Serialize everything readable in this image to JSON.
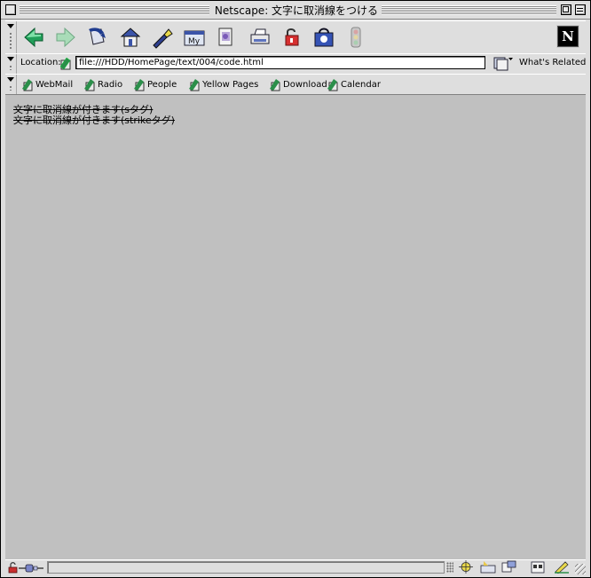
{
  "window": {
    "title": "Netscape: 文字に取消線をつける"
  },
  "nav_toolbar": {
    "buttons": [
      "back",
      "forward",
      "reload",
      "home",
      "search",
      "my-netscape",
      "images",
      "print",
      "security",
      "shop",
      "stop"
    ]
  },
  "location_bar": {
    "label": "Location:",
    "url": "file:///HDD/HomePage/text/004/code.html",
    "related_label": "What's Related"
  },
  "bookmarks": [
    "WebMail",
    "Radio",
    "People",
    "Yellow Pages",
    "Download",
    "Calendar"
  ],
  "content": {
    "lines": [
      "文字に取消線が付きます(sタグ)",
      "文字に取消線が付きます(strikeタグ)"
    ]
  },
  "colors": {
    "chrome": "#dedede",
    "page_background": "#c0c0c0"
  }
}
